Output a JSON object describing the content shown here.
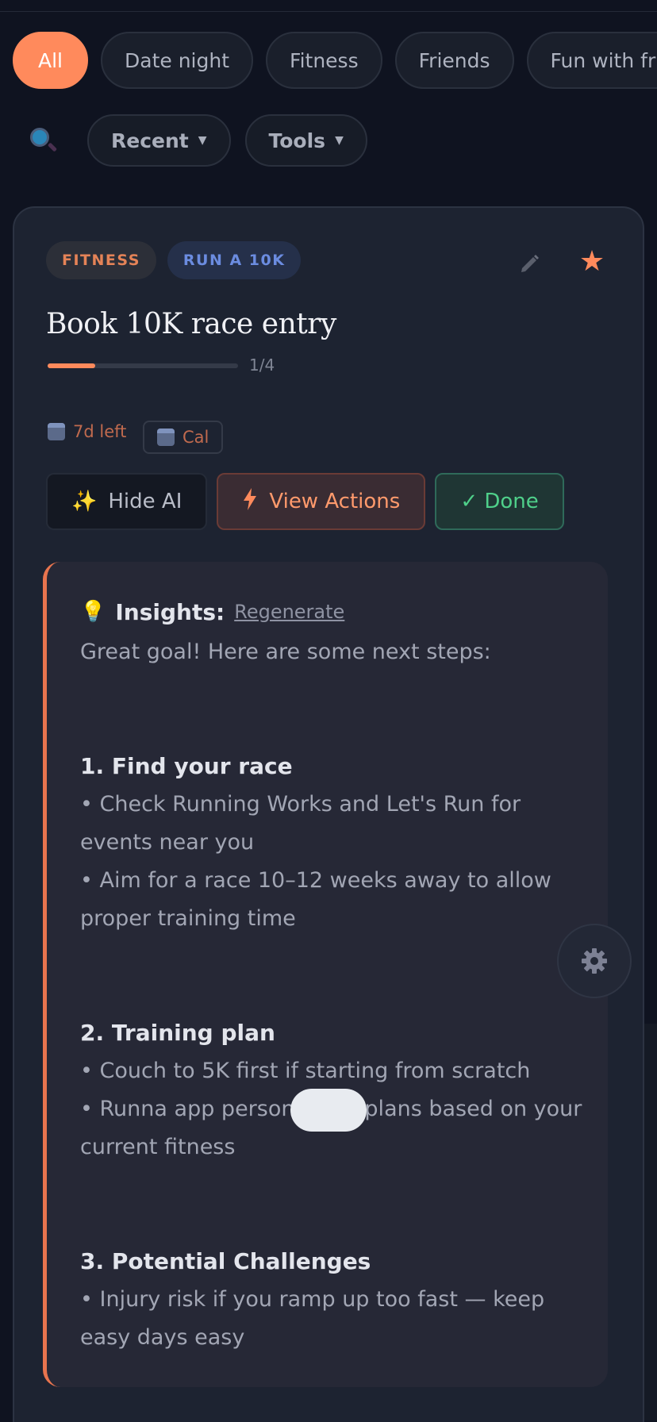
{
  "filters": {
    "chips": [
      "All",
      "Date night",
      "Fitness",
      "Friends",
      "Fun with friends"
    ],
    "active_index": 0
  },
  "toolbar": {
    "search_icon": "search-icon",
    "recent_label": "Recent",
    "tools_label": "Tools"
  },
  "card": {
    "tags": {
      "category": "FITNESS",
      "goal": "RUN A 10K"
    },
    "title": "Book 10K race entry",
    "progress": {
      "text": "1/4",
      "fraction": 0.25
    },
    "due_text": "7d left",
    "cal_label": "Cal",
    "buttons": {
      "hide_ai": "Hide AI",
      "view_actions": "View Actions",
      "done": "✓ Done"
    },
    "insights": {
      "label": "Insights:",
      "regenerate": "Regenerate",
      "intro": "Great goal! Here are some next steps:",
      "sections": [
        {
          "heading": "1. Find your race",
          "bullets": [
            "• Check Running Works and Let's Run for events near you",
            "• Aim for a race 10–12 weeks away to allow proper training time"
          ]
        },
        {
          "heading": "2. Training plan",
          "bullets": [
            "• Couch to 5K first if starting from scratch",
            "• Runna app personalised plans based on your current fitness"
          ]
        },
        {
          "heading": "3. Potential Challenges",
          "bullets": [
            "• Injury risk if you ramp up too fast — keep easy days easy"
          ]
        }
      ]
    }
  },
  "colors": {
    "accent": "#ff8a5c",
    "success": "#4fd08a",
    "background": "#0f1320"
  }
}
